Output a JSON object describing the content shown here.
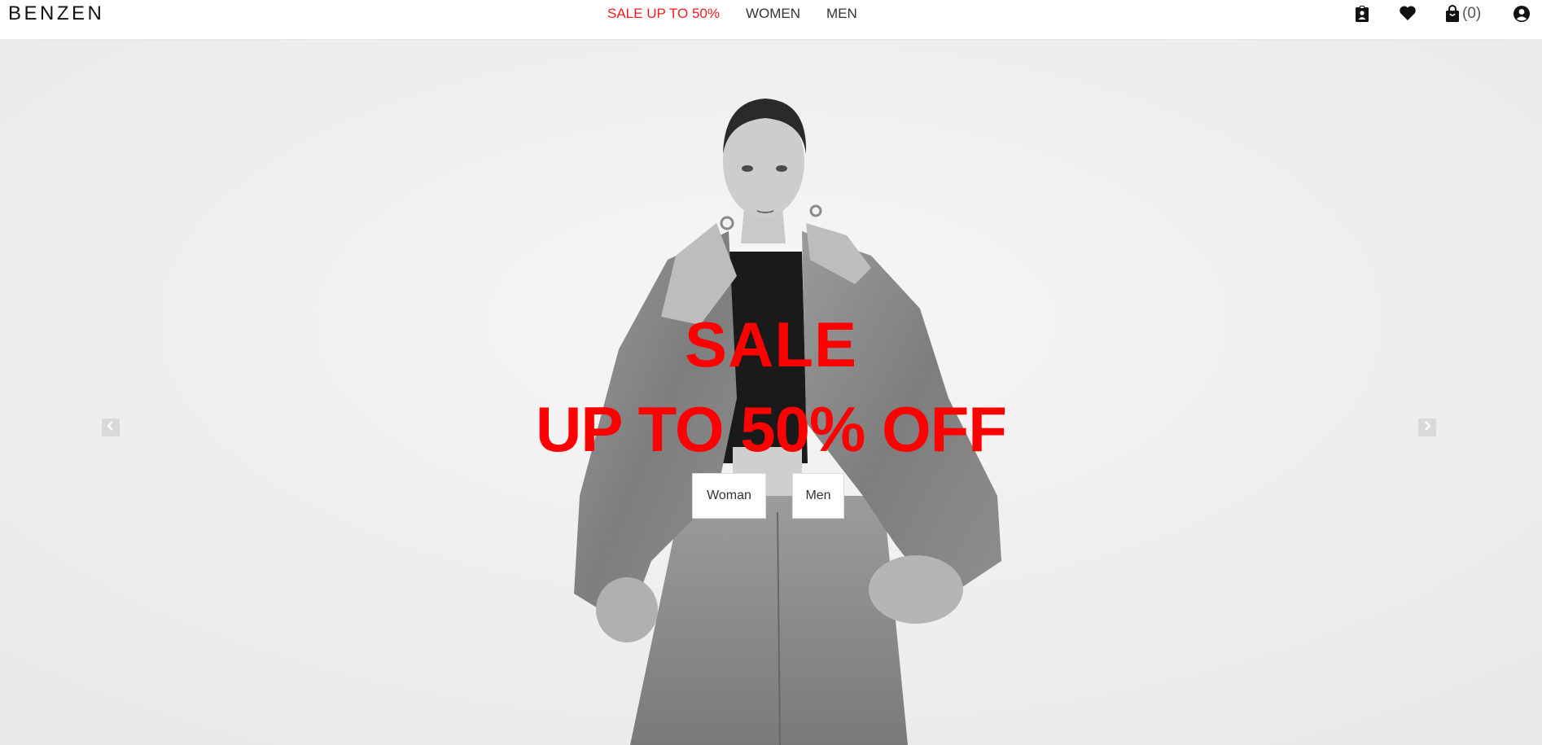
{
  "header": {
    "logo": "BENZEN",
    "nav": [
      {
        "label": "SALE UP TO 50%"
      },
      {
        "label": "WOMEN"
      },
      {
        "label": "MEN"
      }
    ],
    "cart_count": "(0)",
    "icons": [
      "account-card-icon",
      "heart-icon",
      "shopping-bag-icon",
      "user-circle-icon"
    ]
  },
  "hero": {
    "headline_1": "SALE",
    "headline_2": "UP TO 50% OFF",
    "buttons": {
      "woman": "Woman",
      "men": "Men"
    }
  },
  "colors": {
    "sale_red": "#ee1c25",
    "headline_red": "#ff0000",
    "background": "#f2f2f2"
  }
}
